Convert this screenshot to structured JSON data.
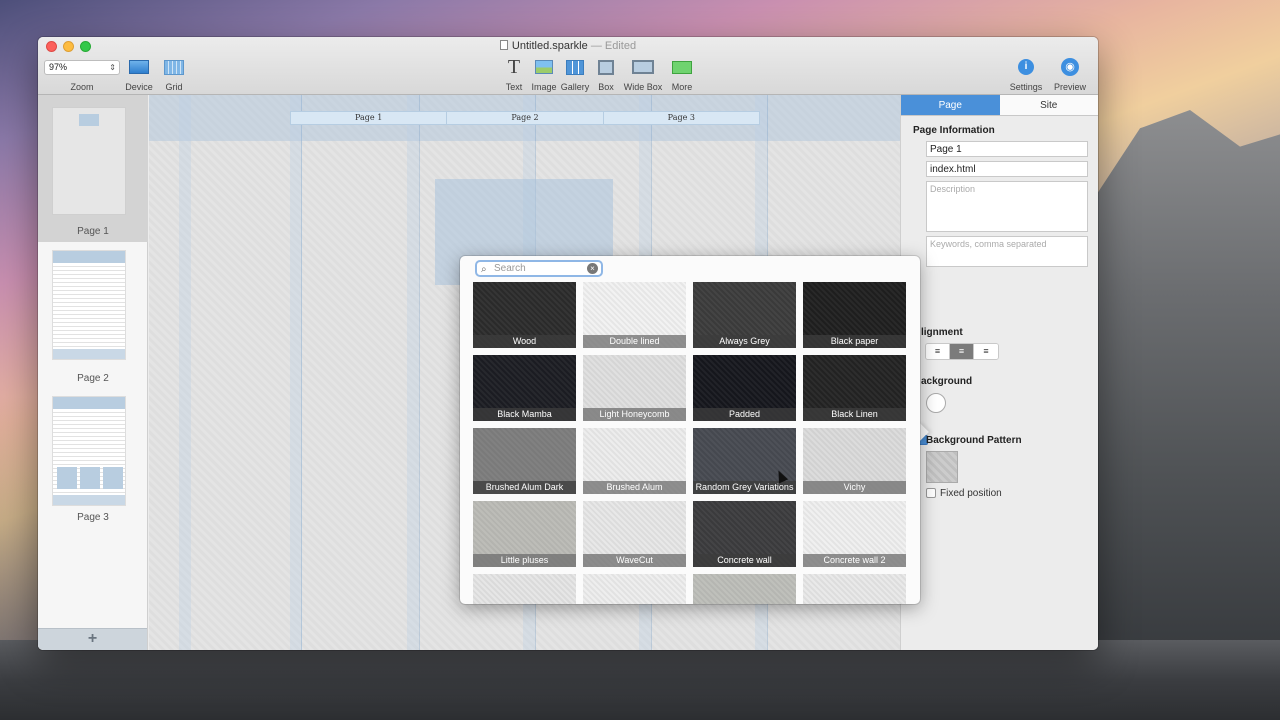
{
  "window": {
    "doc_title": "Untitled.sparkle",
    "edited": "— Edited"
  },
  "toolbar": {
    "zoom_value": "97%",
    "zoom_label": "Zoom",
    "device_label": "Device",
    "grid_label": "Grid",
    "text_label": "Text",
    "image_label": "Image",
    "gallery_label": "Gallery",
    "box_label": "Box",
    "widebox_label": "Wide Box",
    "more_label": "More",
    "settings_label": "Settings",
    "preview_label": "Preview"
  },
  "pages": {
    "items": [
      {
        "label": "Page 1"
      },
      {
        "label": "Page 2"
      },
      {
        "label": "Page 3"
      }
    ],
    "add_label": "+"
  },
  "canvas": {
    "nav": [
      "Page 1",
      "Page 2",
      "Page 3"
    ]
  },
  "inspector": {
    "tabs": [
      "Page",
      "Site"
    ],
    "page_info_heading": "Page Information",
    "page_name": "Page 1",
    "page_file": "index.html",
    "description_placeholder": "Description",
    "keywords_placeholder": "Keywords, comma separated",
    "alignment_heading": "lignment",
    "background_heading": "ackground",
    "background_pattern_label": "Background Pattern",
    "fixed_position_label": "Fixed position",
    "align_icons": [
      "≡",
      "≡",
      "≡"
    ]
  },
  "popover": {
    "search_placeholder": "Search",
    "patterns": [
      {
        "name": "Wood",
        "tone": "#2a2a2a"
      },
      {
        "name": "Double lined",
        "tone": "#f2f2f2"
      },
      {
        "name": "Always Grey",
        "tone": "#3a3a3a"
      },
      {
        "name": "Black paper",
        "tone": "#1e1e1e"
      },
      {
        "name": "Black Mamba",
        "tone": "#1b1c22"
      },
      {
        "name": "Light Honeycomb",
        "tone": "#e0e0e0"
      },
      {
        "name": "Padded",
        "tone": "#15161c"
      },
      {
        "name": "Black Linen",
        "tone": "#222222"
      },
      {
        "name": "Brushed Alum Dark",
        "tone": "#7a7a7a"
      },
      {
        "name": "Brushed Alum",
        "tone": "#ededed"
      },
      {
        "name": "Random Grey Variations",
        "tone": "#45484f"
      },
      {
        "name": "Vichy",
        "tone": "#dcdcdc"
      },
      {
        "name": "Little pluses",
        "tone": "#bdbdb8"
      },
      {
        "name": "WaveCut",
        "tone": "#e8e8e8"
      },
      {
        "name": "Concrete wall",
        "tone": "#3a3a3c"
      },
      {
        "name": "Concrete wall 2",
        "tone": "#f0f0f0"
      },
      {
        "name": "",
        "tone": "#e6e6e6"
      },
      {
        "name": "",
        "tone": "#eeeeee"
      },
      {
        "name": "",
        "tone": "#bfc0bb"
      },
      {
        "name": "",
        "tone": "#e9e9e9"
      }
    ]
  },
  "colors": {
    "accent": "#4a90d9"
  }
}
